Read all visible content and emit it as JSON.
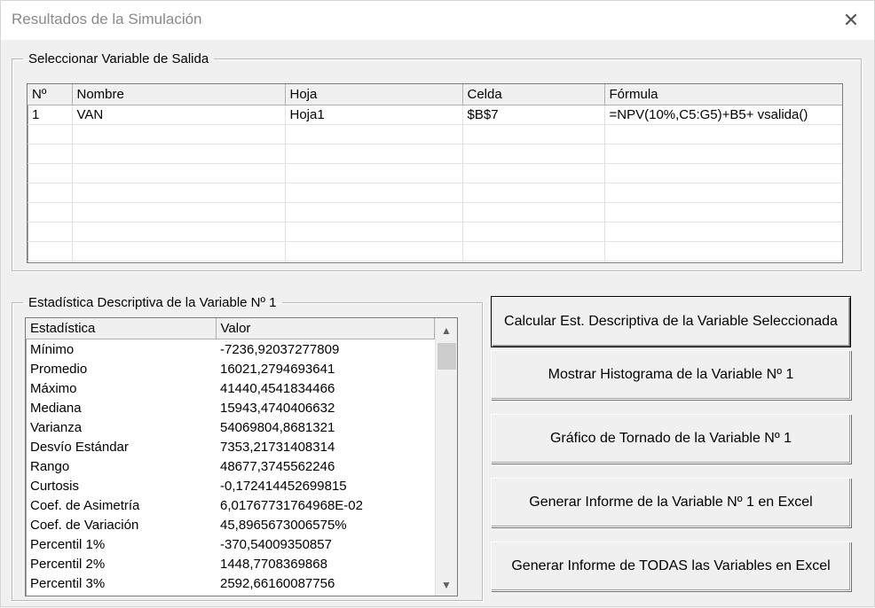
{
  "window": {
    "title": "Resultados de la Simulación",
    "close_glyph": "✕"
  },
  "output_group": {
    "legend": "Seleccionar Variable de Salida",
    "headers": [
      "Nº",
      "Nombre",
      "Hoja",
      "Celda",
      "Fórmula"
    ],
    "rows": [
      [
        "1",
        "VAN",
        "Hoja1",
        "$B$7",
        "=NPV(10%,C5:G5)+B5+ vsalida()"
      ],
      [
        "",
        "",
        "",
        "",
        ""
      ],
      [
        "",
        "",
        "",
        "",
        ""
      ],
      [
        "",
        "",
        "",
        "",
        ""
      ],
      [
        "",
        "",
        "",
        "",
        ""
      ],
      [
        "",
        "",
        "",
        "",
        ""
      ],
      [
        "",
        "",
        "",
        "",
        ""
      ],
      [
        "",
        "",
        "",
        "",
        ""
      ]
    ]
  },
  "stats_group": {
    "legend": "Estadística Descriptiva de la Variable Nº 1",
    "headers": [
      "Estadística",
      "Valor"
    ],
    "rows": [
      [
        "Mínimo",
        "-7236,92037277809"
      ],
      [
        "Promedio",
        "16021,2794693641"
      ],
      [
        "Máximo",
        "41440,4541834466"
      ],
      [
        "Mediana",
        "15943,4740406632"
      ],
      [
        "Varianza",
        "54069804,8681321"
      ],
      [
        "Desvío Estándar",
        "7353,21731408314"
      ],
      [
        "Rango",
        "48677,3745562246"
      ],
      [
        "Curtosis",
        "-0,172414452699815"
      ],
      [
        "Coef. de Asimetría",
        "6,01767731764968E-02"
      ],
      [
        "Coef. de Variación",
        "45,8965673006575%"
      ],
      [
        "Percentil 1%",
        "-370,54009350857"
      ],
      [
        "Percentil 2%",
        "1448,7708369868"
      ],
      [
        "Percentil 3%",
        "2592,66160087756"
      ]
    ],
    "scroll_up_icon": "▲",
    "scroll_down_icon": "▼"
  },
  "buttons": {
    "calc": "Calcular Est. Descriptiva de la Variable Seleccionada",
    "histogram": "Mostrar Histograma de la Variable Nº 1",
    "tornado": "Gráfico de Tornado de la Variable Nº 1",
    "report_one": "Generar Informe de la Variable Nº 1 en Excel",
    "report_all": "Generar Informe de TODAS las Variables en Excel"
  }
}
